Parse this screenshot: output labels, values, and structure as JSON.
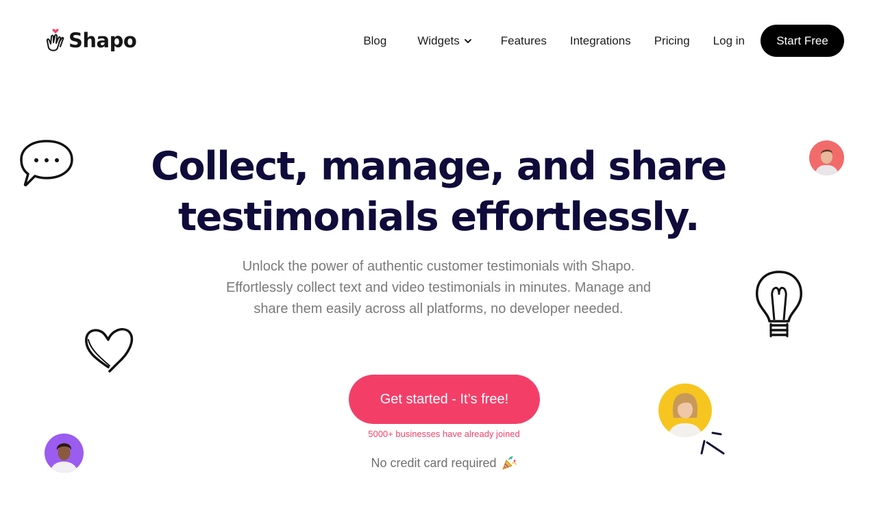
{
  "brand": {
    "name": "Shapo",
    "logo_icon": "clapping-hands-heart-icon"
  },
  "nav": {
    "items": [
      {
        "label": "Blog"
      },
      {
        "label": "Widgets",
        "icon": "chevron-down-icon"
      },
      {
        "label": "Features"
      },
      {
        "label": "Integrations"
      },
      {
        "label": "Pricing"
      },
      {
        "label": "Log in"
      }
    ],
    "cta_label": "Start Free"
  },
  "hero": {
    "title_line1": "Collect, manage, and share",
    "title_line2": "testimonials effortlessly.",
    "subtitle_line1": "Unlock the power of authentic customer testimonials with Shapo.",
    "subtitle_line2": "Effortlessly collect text and video testimonials in minutes. Manage and",
    "subtitle_line3": "share them easily across all platforms, no developer needed.",
    "cta_label": "Get started - It’s free!",
    "joined_text": "5000+ businesses have already joined",
    "no_card_text": "No credit card required",
    "no_card_icon": "party-popper-icon"
  },
  "decorations": [
    "speech-bubble-icon",
    "heart-icon",
    "lightbulb-icon",
    "sparkle-lines-icon"
  ],
  "colors": {
    "accent": "#f33f68",
    "title": "#0f0b3a",
    "nav_cta_bg": "#000000"
  }
}
